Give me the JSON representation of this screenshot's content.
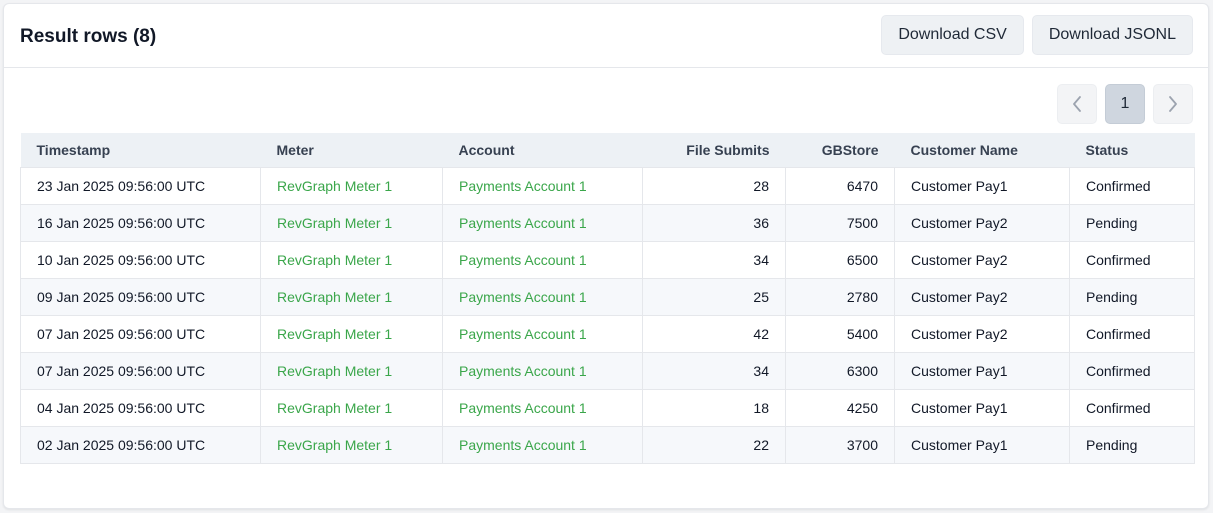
{
  "header": {
    "title": "Result rows (8)",
    "download_csv": "Download CSV",
    "download_jsonl": "Download JSONL"
  },
  "pagination": {
    "current_page": "1",
    "prev_icon": "chevron-left-icon",
    "next_icon": "chevron-right-icon"
  },
  "table": {
    "columns": [
      "Timestamp",
      "Meter",
      "Account",
      "File Submits",
      "GBStore",
      "Customer Name",
      "Status"
    ],
    "rows": [
      {
        "timestamp": "23 Jan 2025 09:56:00 UTC",
        "meter": "RevGraph Meter 1",
        "account": "Payments Account 1",
        "file_submits": "28",
        "gbstore": "6470",
        "customer": "Customer Pay1",
        "status": "Confirmed"
      },
      {
        "timestamp": "16 Jan 2025 09:56:00 UTC",
        "meter": "RevGraph Meter 1",
        "account": "Payments Account 1",
        "file_submits": "36",
        "gbstore": "7500",
        "customer": "Customer Pay2",
        "status": "Pending"
      },
      {
        "timestamp": "10 Jan 2025 09:56:00 UTC",
        "meter": "RevGraph Meter 1",
        "account": "Payments Account 1",
        "file_submits": "34",
        "gbstore": "6500",
        "customer": "Customer Pay2",
        "status": "Confirmed"
      },
      {
        "timestamp": "09 Jan 2025 09:56:00 UTC",
        "meter": "RevGraph Meter 1",
        "account": "Payments Account 1",
        "file_submits": "25",
        "gbstore": "2780",
        "customer": "Customer Pay2",
        "status": "Pending"
      },
      {
        "timestamp": "07 Jan 2025 09:56:00 UTC",
        "meter": "RevGraph Meter 1",
        "account": "Payments Account 1",
        "file_submits": "42",
        "gbstore": "5400",
        "customer": "Customer Pay2",
        "status": "Confirmed"
      },
      {
        "timestamp": "07 Jan 2025 09:56:00 UTC",
        "meter": "RevGraph Meter 1",
        "account": "Payments Account 1",
        "file_submits": "34",
        "gbstore": "6300",
        "customer": "Customer Pay1",
        "status": "Confirmed"
      },
      {
        "timestamp": "04 Jan 2025 09:56:00 UTC",
        "meter": "RevGraph Meter 1",
        "account": "Payments Account 1",
        "file_submits": "18",
        "gbstore": "4250",
        "customer": "Customer Pay1",
        "status": "Confirmed"
      },
      {
        "timestamp": "02 Jan 2025 09:56:00 UTC",
        "meter": "RevGraph Meter 1",
        "account": "Payments Account 1",
        "file_submits": "22",
        "gbstore": "3700",
        "customer": "Customer Pay1",
        "status": "Pending"
      }
    ]
  },
  "colors": {
    "link": "#3aa64a",
    "header_bg": "#edf1f5",
    "row_alt_bg": "#f6f8fb",
    "button_bg": "#eef1f4",
    "active_page_bg": "#cfd6df"
  }
}
